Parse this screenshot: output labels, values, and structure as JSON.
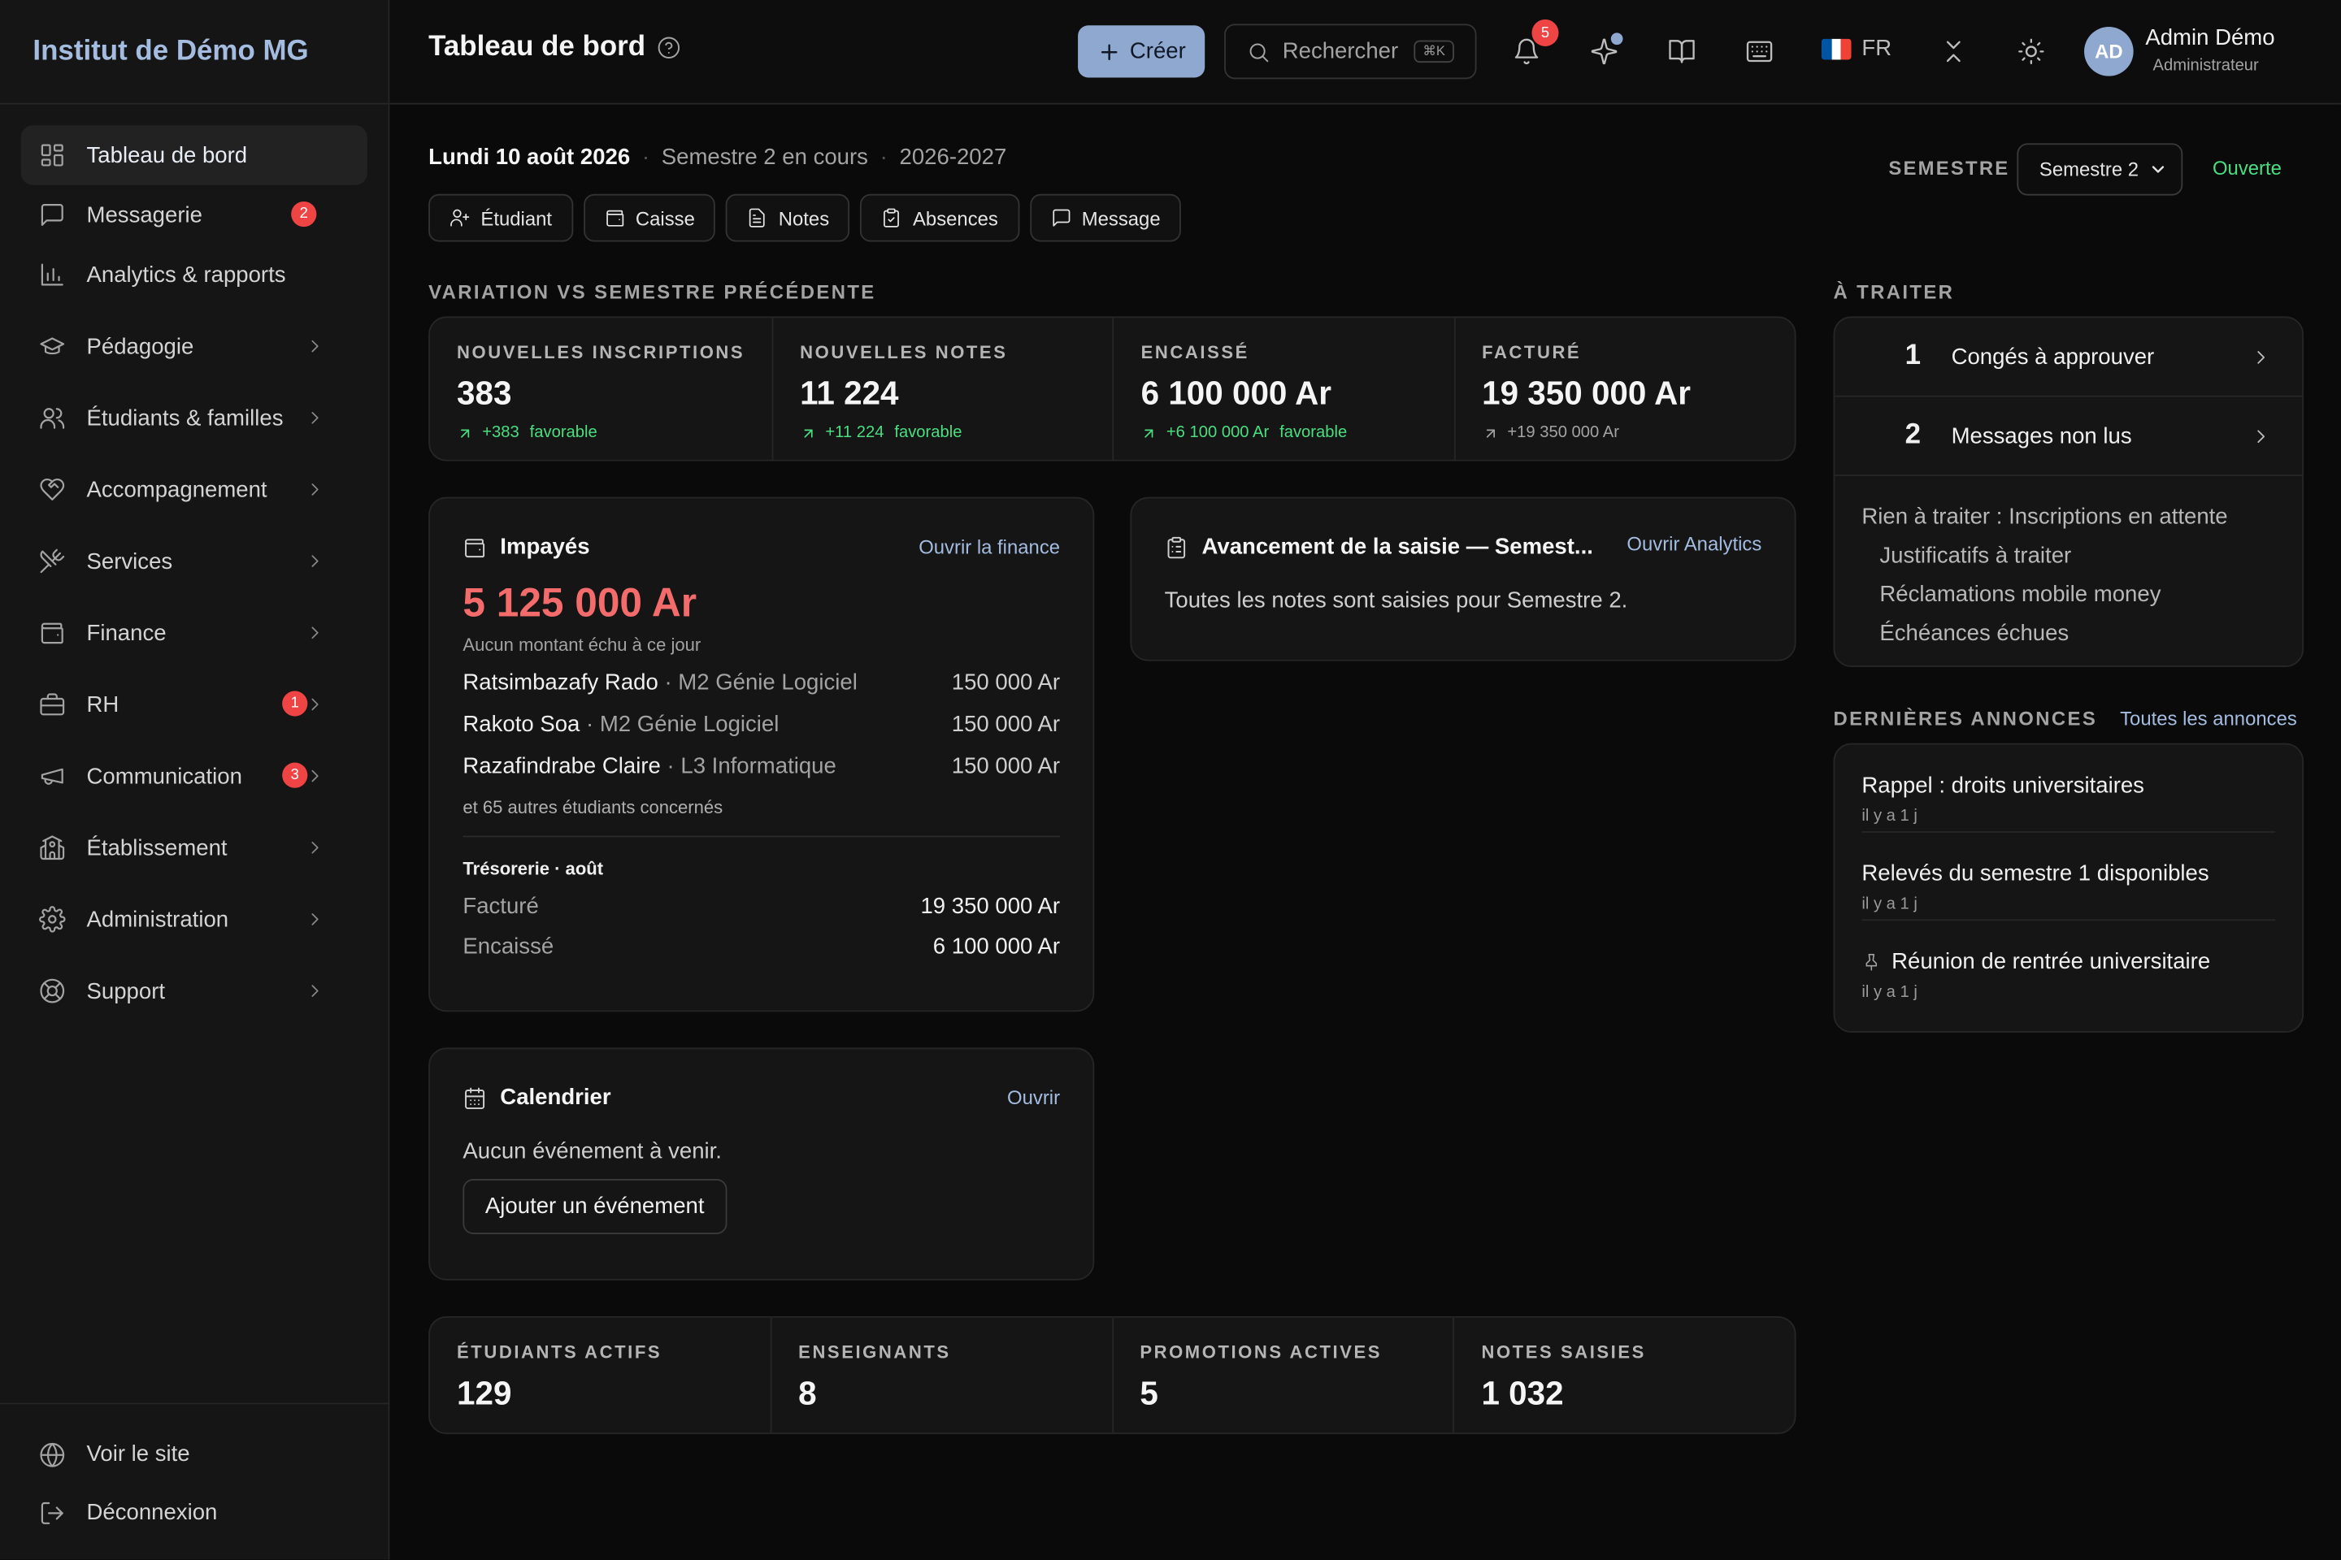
{
  "brand": "Institut de Démo MG",
  "sidebar": {
    "items": [
      {
        "label": "Tableau de bord"
      },
      {
        "label": "Messagerie",
        "badge": "2"
      },
      {
        "label": "Analytics & rapports"
      },
      {
        "label": "Pédagogie"
      },
      {
        "label": "Étudiants & familles"
      },
      {
        "label": "Accompagnement"
      },
      {
        "label": "Services"
      },
      {
        "label": "Finance"
      },
      {
        "label": "RH",
        "badge": "1"
      },
      {
        "label": "Communication",
        "badge": "3"
      },
      {
        "label": "Établissement"
      },
      {
        "label": "Administration"
      },
      {
        "label": "Support"
      }
    ],
    "footer": [
      {
        "label": "Voir le site"
      },
      {
        "label": "Déconnexion"
      }
    ]
  },
  "topbar": {
    "title": "Tableau de bord",
    "create_label": "Créer",
    "search_placeholder": "Rechercher",
    "search_kbd": "⌘K",
    "notif_count": "5",
    "lang": "FR",
    "avatar_initials": "AD",
    "user_name": "Admin Démo",
    "user_role": "Administrateur"
  },
  "header": {
    "date": "Lundi 10 août 2026",
    "semester_status": "Semestre 2 en cours",
    "year": "2026-2027",
    "semester_label": "SEMESTRE",
    "semester_selected": "Semestre 2",
    "semester_state": "Ouverte"
  },
  "quick_actions": [
    "Étudiant",
    "Caisse",
    "Notes",
    "Absences",
    "Message"
  ],
  "variation": {
    "label": "VARIATION VS SEMESTRE PRÉCÉDENTE",
    "kpis": [
      {
        "label": "NOUVELLES INSCRIPTIONS",
        "value": "383",
        "trend": "+383",
        "fav": "favorable"
      },
      {
        "label": "NOUVELLES NOTES",
        "value": "11 224",
        "trend": "+11 224",
        "fav": "favorable"
      },
      {
        "label": "ENCAISSÉ",
        "value": "6 100 000 Ar",
        "trend": "+6 100 000 Ar",
        "fav": "favorable"
      },
      {
        "label": "FACTURÉ",
        "value": "19 350 000 Ar",
        "trend": "+19 350 000 Ar",
        "fav": ""
      }
    ]
  },
  "impayes": {
    "title": "Impayés",
    "link": "Ouvrir la finance",
    "amount": "5 125 000 Ar",
    "note": "Aucun montant échu à ce jour",
    "rows": [
      {
        "name": "Ratsimbazafy Rado",
        "sub": "· M2 Génie Logiciel",
        "amount": "150 000 Ar"
      },
      {
        "name": "Rakoto Soa",
        "sub": "· M2 Génie Logiciel",
        "amount": "150 000 Ar"
      },
      {
        "name": "Razafindrabe Claire",
        "sub": "· L3 Informatique",
        "amount": "150 000 Ar"
      }
    ],
    "others": "et 65 autres étudiants concernés",
    "treasury_title": "Trésorerie · août",
    "treasury": [
      {
        "label": "Facturé",
        "amount": "19 350 000 Ar"
      },
      {
        "label": "Encaissé",
        "amount": "6 100 000 Ar"
      }
    ]
  },
  "saisie": {
    "title": "Avancement de la saisie — Semest...",
    "link": "Ouvrir Analytics",
    "text": "Toutes les notes sont saisies pour Semestre 2."
  },
  "calendar": {
    "title": "Calendrier",
    "link": "Ouvrir",
    "text": "Aucun événement à venir.",
    "button": "Ajouter un événement"
  },
  "stats": [
    {
      "label": "ÉTUDIANTS ACTIFS",
      "value": "129"
    },
    {
      "label": "ENSEIGNANTS",
      "value": "8"
    },
    {
      "label": "PROMOTIONS ACTIVES",
      "value": "5"
    },
    {
      "label": "NOTES SAISIES",
      "value": "1 032"
    }
  ],
  "todo": {
    "label": "À TRAITER",
    "items": [
      {
        "count": "1",
        "label": "Congés à approuver"
      },
      {
        "count": "2",
        "label": "Messages non lus"
      }
    ],
    "nothing_label": "Rien à traiter :",
    "nothing": [
      "Inscriptions en attente",
      "Justificatifs à traiter",
      "Réclamations mobile money",
      "Échéances échues"
    ]
  },
  "announcements": {
    "label": "DERNIÈRES ANNONCES",
    "link": "Toutes les annonces",
    "items": [
      {
        "title": "Rappel : droits universitaires",
        "time": "il y a 1 j"
      },
      {
        "title": "Relevés du semestre 1 disponibles",
        "time": "il y a 1 j"
      },
      {
        "title": "Réunion de rentrée universitaire",
        "time": "il y a 1 j"
      }
    ]
  },
  "colors": {
    "accent": "#8fa8cf",
    "danger": "#f36b6b",
    "positive": "#4ade80"
  }
}
